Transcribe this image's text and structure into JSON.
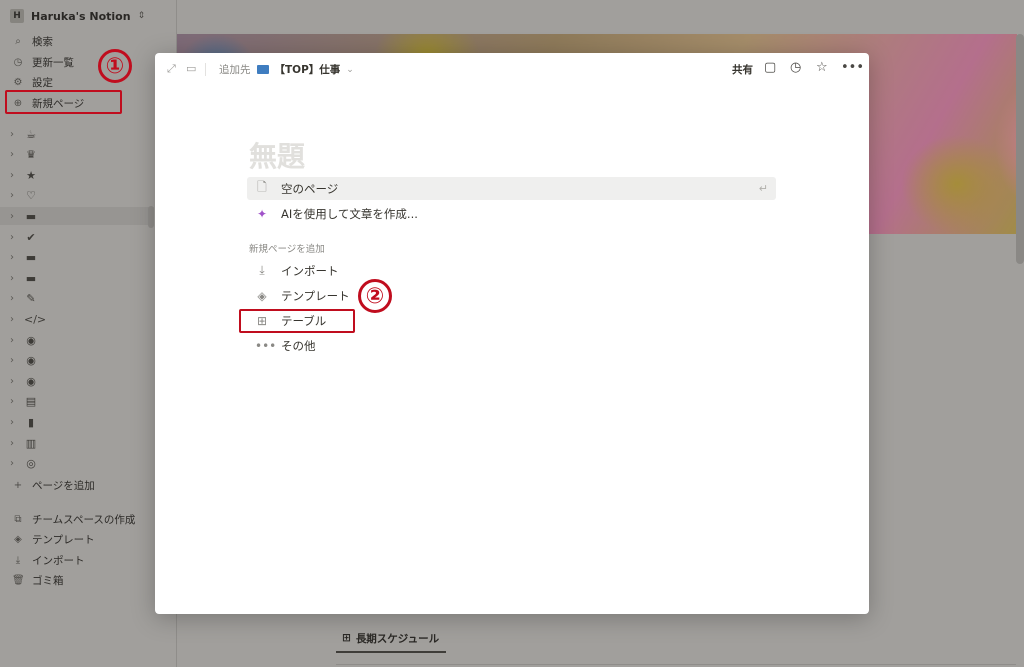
{
  "workspace": {
    "avatar": "H",
    "name": "Haruka's Notion"
  },
  "sidebar": {
    "nav": [
      {
        "label": "検索",
        "icon": "search-icon",
        "glyph": "⌕"
      },
      {
        "label": "更新一覧",
        "icon": "clock-icon",
        "glyph": "◷"
      },
      {
        "label": "設定",
        "icon": "gear-icon",
        "glyph": "⚙"
      },
      {
        "label": "新規ページ",
        "icon": "plus-circle-icon",
        "glyph": "⊕"
      }
    ],
    "tree": [
      {
        "icon": "coffee-icon",
        "glyph": "☕"
      },
      {
        "icon": "crown-icon",
        "glyph": "♛"
      },
      {
        "icon": "star-icon",
        "glyph": "★"
      },
      {
        "icon": "heart-icon",
        "glyph": "♡"
      },
      {
        "icon": "monitor-icon",
        "glyph": "▬"
      },
      {
        "icon": "check-circle-icon",
        "glyph": "✔"
      },
      {
        "icon": "monitor-icon",
        "glyph": "▬"
      },
      {
        "icon": "monitor-icon",
        "glyph": "▬"
      },
      {
        "icon": "wrench-icon",
        "glyph": "✎"
      },
      {
        "icon": "code-icon",
        "glyph": "</>"
      },
      {
        "icon": "palette-icon",
        "glyph": "◉"
      },
      {
        "icon": "palette-icon",
        "glyph": "◉"
      },
      {
        "icon": "palette-icon",
        "glyph": "◉"
      },
      {
        "icon": "book-icon",
        "glyph": "▤"
      },
      {
        "icon": "bookmark-icon",
        "glyph": "▮"
      },
      {
        "icon": "open-book-icon",
        "glyph": "▥"
      },
      {
        "icon": "target-icon",
        "glyph": "◎"
      }
    ],
    "add_page": "ページを追加",
    "bottom": [
      {
        "label": "チームスペースの作成",
        "icon": "teamspace-icon",
        "glyph": "⧉"
      },
      {
        "label": "テンプレート",
        "icon": "shapes-icon",
        "glyph": "◈"
      },
      {
        "label": "インポート",
        "icon": "download-icon",
        "glyph": "⤓"
      },
      {
        "label": "ゴミ箱",
        "icon": "trash-icon",
        "glyph": "🗑"
      }
    ]
  },
  "background": {
    "tab_label": "長期スケジュール"
  },
  "modal": {
    "breadcrumb_prefix": "追加先",
    "breadcrumb_page": "【TOP】仕事",
    "share": "共有",
    "title_placeholder": "無題",
    "options": [
      {
        "label": "空のページ",
        "icon": "page-icon",
        "glyph": "🗋",
        "enter": "↵"
      },
      {
        "label": "AIを使用して文章を作成...",
        "icon": "ai-sparkle-icon",
        "glyph": "✦"
      }
    ],
    "section_label": "新規ページを追加",
    "add_options": [
      {
        "label": "インポート",
        "icon": "import-icon",
        "glyph": "⤓"
      },
      {
        "label": "テンプレート",
        "icon": "shapes-icon",
        "glyph": "◈"
      },
      {
        "label": "テーブル",
        "icon": "table-icon",
        "glyph": "⊞"
      },
      {
        "label": "その他",
        "icon": "more-icon",
        "glyph": "•••"
      }
    ]
  },
  "annotations": {
    "one": "①",
    "two": "②",
    "color": "#c00d1e"
  }
}
